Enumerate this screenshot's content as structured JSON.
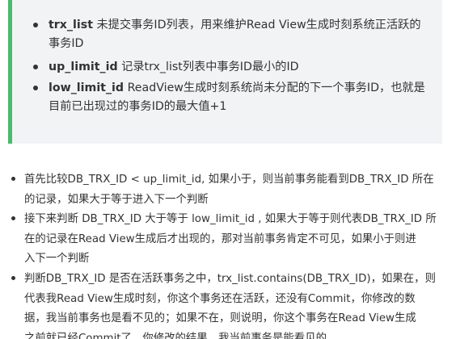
{
  "callout": {
    "items": [
      {
        "term": "trx_list",
        "line1": " 未提交事务ID列表，用来维护Read View生成时刻系统正活跃的",
        "line2": "事务ID"
      },
      {
        "term": "up_limit_id",
        "line1": " 记录trx_list列表中事务ID最小的ID",
        "line2": ""
      },
      {
        "term": "low_limit_id",
        "line1": " ReadView生成时刻系统尚未分配的下一个事务ID，也就是",
        "line2": "目前已出现过的事务ID的最大值+1"
      }
    ]
  },
  "list": {
    "items": [
      {
        "line1": "首先比较DB_TRX_ID < up_limit_id, 如果小于，则当前事务能看到DB_TRX_ID 所在",
        "line2": "的记录，如果大于等于进入下一个判断"
      },
      {
        "line1": "接下来判断 DB_TRX_ID 大于等于 low_limit_id , 如果大于等于则代表DB_TRX_ID 所",
        "line2": "在的记录在Read View生成后才出现的，那对当前事务肯定不可见，如果小于则进",
        "line3": "入下一个判断"
      },
      {
        "line1": "判断DB_TRX_ID 是否在活跃事务之中，trx_list.contains(DB_TRX_ID)，如果在，则",
        "line2": "代表我Read View生成时刻，你这个事务还在活跃，还没有Commit，你修改的数",
        "line3": "据，我当前事务也是看不见的；如果不在，则说明，你这个事务在Read View生成",
        "line4": "之前就已经Commit了，你修改的结果，我当前事务是能看见的"
      }
    ]
  }
}
